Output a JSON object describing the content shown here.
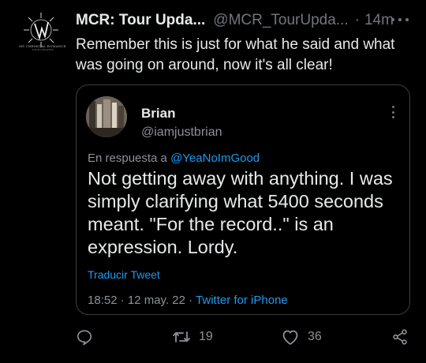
{
  "tweet": {
    "author": {
      "display_name": "MCR: Tour Upda...",
      "handle": "@MCR_TourUpda...",
      "separator": "·",
      "time": "14m",
      "avatar_caption": "MY CHEMICAL ROMANCE",
      "avatar_subcaption": "TOUR UPDATES"
    },
    "text": "Remember this is just for what he said and what was going on around, now it's all clear!",
    "more_icon": "more-horizontal-icon"
  },
  "quote": {
    "display_name": "Brian",
    "handle": "@iamjustbrian",
    "reply_prefix": "En respuesta a ",
    "reply_mention": "@YeaNoImGood",
    "text": "Not getting away with anything. I was simply clarifying what 5400 seconds meant. \"For the record..\" is an expression. Lordy.",
    "translate_label": "Traducir Tweet",
    "timestamp": "18:52 · 12 may. 22 · ",
    "source": "Twitter for iPhone"
  },
  "actions": {
    "reply_icon": "reply-icon",
    "retweet_icon": "retweet-icon",
    "retweet_count": "19",
    "like_icon": "heart-icon",
    "like_count": "36",
    "share_icon": "share-icon"
  },
  "colors": {
    "background": "#000000",
    "text": "#e7e9ea",
    "muted": "#71767b",
    "link": "#1d9bf0",
    "border": "#3a3d40"
  }
}
